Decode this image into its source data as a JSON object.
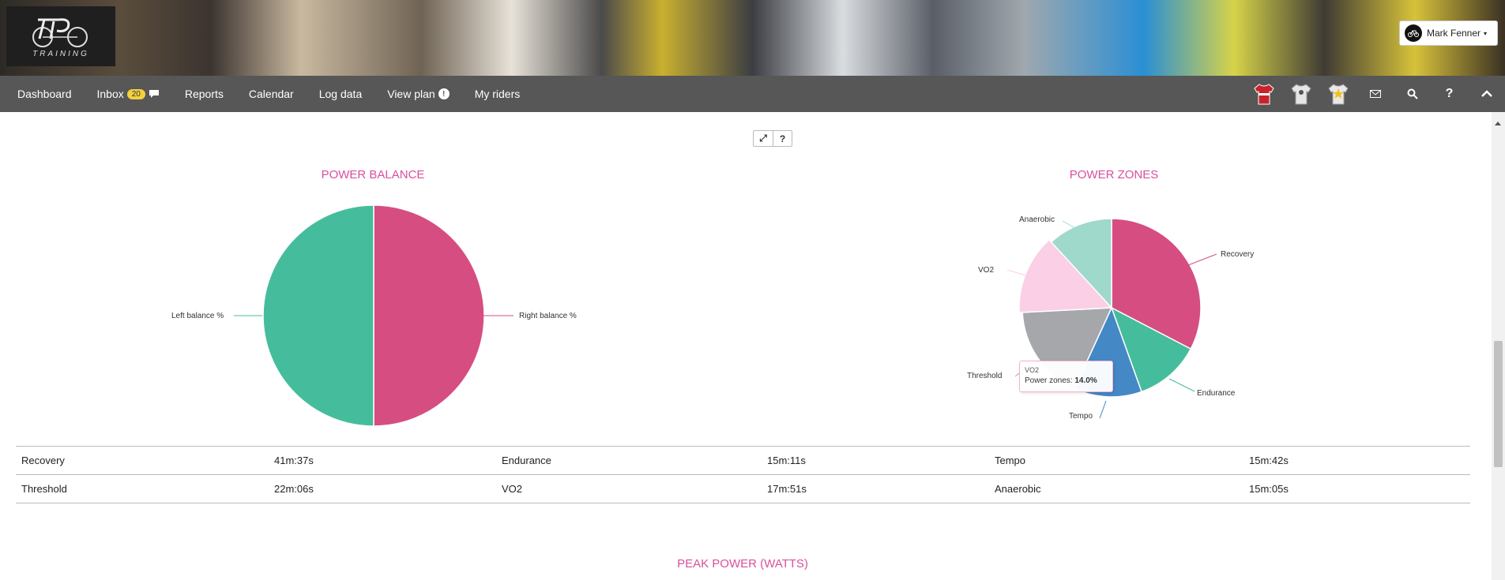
{
  "header": {
    "logo_text": "TRAINING",
    "user_name": "Mark Fenner"
  },
  "nav": {
    "items": [
      {
        "label": "Dashboard"
      },
      {
        "label": "Inbox",
        "badge": "20"
      },
      {
        "label": "Reports"
      },
      {
        "label": "Calendar"
      },
      {
        "label": "Log data"
      },
      {
        "label": "View plan"
      },
      {
        "label": "My riders"
      }
    ],
    "right_icons": [
      "red-jersey-icon",
      "white-jersey-icon",
      "yellow-star-jersey-icon",
      "mail-icon",
      "search-icon",
      "help-icon",
      "collapse-up-icon"
    ]
  },
  "toolbar": {
    "expand_label": "⤢",
    "help_label": "?"
  },
  "power_balance": {
    "title": "POWER BALANCE",
    "left_label": "Left balance %",
    "right_label": "Right balance %"
  },
  "power_zones": {
    "title": "POWER ZONES",
    "labels": {
      "anaerobic": "Anaerobic",
      "recovery": "Recovery",
      "vo2": "VO2",
      "threshold": "Threshold",
      "endurance": "Endurance",
      "tempo": "Tempo"
    },
    "tooltip": {
      "title": "VO2",
      "label": "Power zones: ",
      "value": "14.0%"
    }
  },
  "zone_table": {
    "rows": [
      [
        {
          "name": "Recovery",
          "time": "41m:37s"
        },
        {
          "name": "Endurance",
          "time": "15m:11s"
        },
        {
          "name": "Tempo",
          "time": "15m:42s"
        }
      ],
      [
        {
          "name": "Threshold",
          "time": "22m:06s"
        },
        {
          "name": "VO2",
          "time": "17m:51s"
        },
        {
          "name": "Anaerobic",
          "time": "15m:05s"
        }
      ]
    ]
  },
  "peak_power": {
    "title": "PEAK POWER (WATTS)"
  },
  "chart_data": [
    {
      "type": "pie",
      "title": "POWER BALANCE",
      "categories": [
        "Right balance %",
        "Left balance %"
      ],
      "values": [
        50,
        50
      ],
      "colors": [
        "#d64d82",
        "#45bd9c"
      ]
    },
    {
      "type": "pie",
      "title": "POWER ZONES",
      "categories": [
        "Recovery",
        "Endurance",
        "Tempo",
        "Threshold",
        "VO2",
        "Anaerobic"
      ],
      "values": [
        32.6,
        11.9,
        12.3,
        17.3,
        14.0,
        11.8
      ],
      "colors": [
        "#d64d82",
        "#45bd9c",
        "#4588c6",
        "#a6a7ab",
        "#fbcfe6",
        "#9fd9cb"
      ]
    }
  ]
}
